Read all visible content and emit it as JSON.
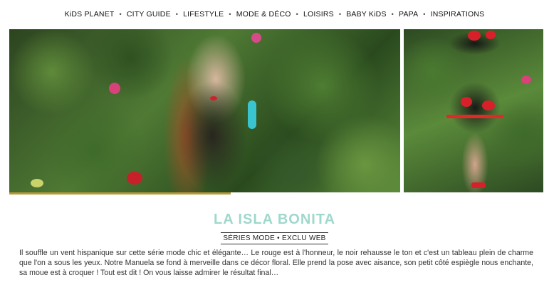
{
  "nav": {
    "items": [
      {
        "label": "KiDS PLANET"
      },
      {
        "label": "CITY GUIDE"
      },
      {
        "label": "LIFESTYLE"
      },
      {
        "label": "MODE & DÉCO"
      },
      {
        "label": "LOISIRS"
      },
      {
        "label": "BABY KiDS"
      },
      {
        "label": "PAPA"
      },
      {
        "label": "INSPIRATIONS"
      }
    ],
    "separator": "•"
  },
  "article": {
    "title": "LA ISLA BONITA",
    "category": "SÉRIES MODE • EXCLU WEB",
    "excerpt": "Il souffle un vent hispanique sur cette série mode chic et élégante… Le rouge est à l'honneur, le noir rehausse le ton et c'est un tableau plein de charme que l'on a sous les yeux. Notre Manuela se fond à merveille dans ce décor floral. Elle prend la pose avec aisance, son petit côté espiègle nous enchante, sa moue est à croquer ! Tout est dit ! On vous laisse admirer le résultat final…"
  },
  "colors": {
    "title": "#9fd8cc",
    "accent_bar": "#b79a3a"
  }
}
